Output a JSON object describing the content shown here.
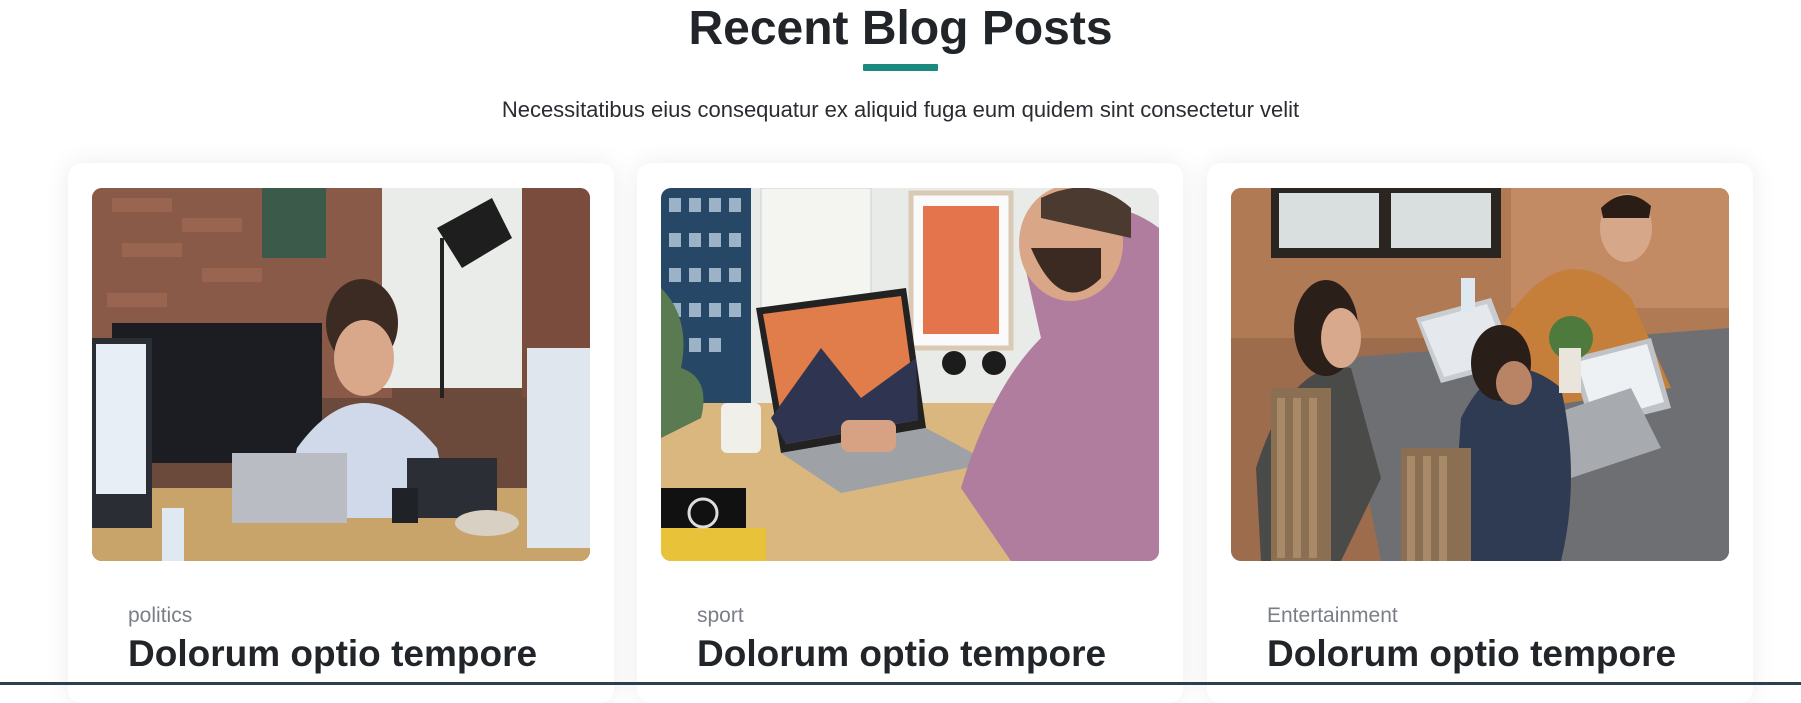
{
  "section": {
    "title": "Recent Blog Posts",
    "subtitle": "Necessitatibus eius consequatur ex aliquid fuga eum quidem sint consectetur velit",
    "accent_color": "#1a8a80"
  },
  "posts": [
    {
      "category": "politics",
      "title": "Dolorum optio tempore"
    },
    {
      "category": "sport",
      "title": "Dolorum optio tempore"
    },
    {
      "category": "Entertainment",
      "title": "Dolorum optio tempore"
    }
  ]
}
